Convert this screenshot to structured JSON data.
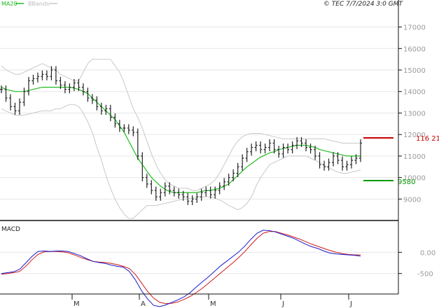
{
  "header": {
    "legend_ma": "MA20",
    "legend_bb": "BBands",
    "copyright": "© TEC 7/7/2024 3:0 GMT"
  },
  "colors": {
    "ma": "#22bb22",
    "bbands": "#c8c8c8",
    "price_bars": "#222222",
    "resistance": "#cc0000",
    "support": "#009900",
    "macd": "#1a1acc",
    "signal": "#cc1a1a",
    "grid": "#e6e6e6",
    "axis": "#111111"
  },
  "price_axis": {
    "labels": [
      "9000",
      "10000",
      "11000",
      "12000",
      "13000",
      "14000",
      "15000",
      "16000",
      "17000"
    ],
    "range": [
      8100,
      17800
    ]
  },
  "levels": {
    "resistance": {
      "value": 11621,
      "label": "116 21"
    },
    "support": {
      "value": 9580,
      "label": "9580"
    }
  },
  "macd_panel": {
    "title": "MACD",
    "labels": [
      "0.00",
      "-500"
    ]
  },
  "months": [
    "M",
    "A",
    "M",
    "J",
    "J"
  ],
  "chart_data": {
    "type": "line",
    "ylim": [
      8100,
      17800
    ],
    "price": [
      14100,
      13700,
      13300,
      13100,
      13500,
      14000,
      14500,
      14600,
      14700,
      14800,
      14700,
      15000,
      14500,
      14300,
      14100,
      14200,
      14400,
      14200,
      14000,
      13700,
      13600,
      13300,
      13100,
      13200,
      12800,
      12500,
      12300,
      12300,
      12200,
      12100,
      11000,
      10000,
      9700,
      9400,
      9100,
      9300,
      9600,
      9400,
      9300,
      9200,
      9100,
      8900,
      9000,
      9100,
      9300,
      9400,
      9200,
      9400,
      9600,
      9800,
      10000,
      10200,
      10500,
      10900,
      11200,
      11400,
      11500,
      11300,
      11400,
      11600,
      11300,
      11100,
      11400,
      11300,
      11500,
      11700,
      11600,
      11400,
      11300,
      11000,
      10600,
      10500,
      10700,
      11000,
      10800,
      10500,
      10600,
      10800,
      10900,
      11600
    ],
    "ma20": [
      14200,
      14100,
      14050,
      14000,
      14000,
      14000,
      14050,
      14100,
      14150,
      14200,
      14200,
      14200,
      14200,
      14200,
      14200,
      14200,
      14150,
      14100,
      14000,
      13900,
      13700,
      13500,
      13300,
      13100,
      12900,
      12700,
      12400,
      12100,
      11700,
      11300,
      10900,
      10600,
      10300,
      10000,
      9800,
      9600,
      9450,
      9350,
      9300,
      9300,
      9300,
      9300,
      9300,
      9300,
      9350,
      9400,
      9400,
      9450,
      9500,
      9600,
      9700,
      9900,
      10100,
      10300,
      10500,
      10650,
      10800,
      10950,
      11050,
      11150,
      11200,
      11300,
      11350,
      11400,
      11450,
      11500,
      11500,
      11500,
      11450,
      11400,
      11300,
      11250,
      11200,
      11150,
      11100,
      11050,
      11000,
      11000,
      11000,
      11000
    ],
    "bb_upper": [
      15200,
      15000,
      14900,
      14800,
      14800,
      14900,
      15000,
      15100,
      15200,
      15300,
      15200,
      15100,
      15000,
      14800,
      14700,
      14600,
      14500,
      14500,
      14900,
      15300,
      15500,
      15500,
      15500,
      15500,
      15500,
      15200,
      14900,
      14400,
      13800,
      13200,
      12800,
      12300,
      11700,
      11100,
      10600,
      10200,
      9900,
      9700,
      9600,
      9500,
      9500,
      9500,
      9400,
      9400,
      9500,
      9600,
      9700,
      9900,
      10200,
      10600,
      11000,
      11400,
      11700,
      11900,
      12000,
      12050,
      12050,
      12050,
      12000,
      11950,
      11900,
      11850,
      11800,
      11800,
      11800,
      11800,
      11800,
      11800,
      11800,
      11800,
      11800,
      11800,
      11750,
      11700,
      11650,
      11600,
      11600,
      11600,
      11600,
      11600
    ],
    "bb_lower": [
      13200,
      13100,
      13000,
      12900,
      12900,
      12900,
      12950,
      13000,
      13050,
      13100,
      13100,
      13100,
      13200,
      13200,
      13300,
      13400,
      13400,
      13300,
      13000,
      12600,
      12100,
      11400,
      10800,
      10100,
      9500,
      9000,
      8600,
      8300,
      8100,
      8100,
      8300,
      8500,
      8700,
      8700,
      8700,
      8750,
      8800,
      8850,
      8900,
      8950,
      9000,
      9000,
      9050,
      9100,
      9100,
      9100,
      9100,
      9050,
      8950,
      8850,
      8700,
      8600,
      8500,
      8600,
      8800,
      9100,
      9600,
      10000,
      10300,
      10600,
      10700,
      10800,
      10900,
      11000,
      11000,
      11000,
      11000,
      11000,
      10900,
      10800,
      10700,
      10550,
      10450,
      10350,
      10250,
      10200,
      10200,
      10250,
      10300,
      10350
    ],
    "macd": [
      -500,
      -480,
      -460,
      -400,
      -250,
      -100,
      20,
      30,
      20,
      30,
      30,
      20,
      -30,
      -80,
      -150,
      -210,
      -240,
      -260,
      -300,
      -330,
      -350,
      -450,
      -650,
      -900,
      -1100,
      -1250,
      -1280,
      -1240,
      -1180,
      -1120,
      -1050,
      -950,
      -820,
      -700,
      -580,
      -450,
      -320,
      -210,
      -100,
      10,
      150,
      310,
      450,
      520,
      510,
      480,
      430,
      380,
      330,
      260,
      190,
      130,
      90,
      30,
      -20,
      -40,
      -50,
      -60,
      -70,
      -90
    ],
    "signal": [
      -520,
      -500,
      -480,
      -450,
      -330,
      -180,
      -50,
      10,
      20,
      20,
      10,
      -10,
      -60,
      -120,
      -170,
      -210,
      -230,
      -240,
      -260,
      -290,
      -330,
      -380,
      -520,
      -720,
      -920,
      -1080,
      -1180,
      -1210,
      -1200,
      -1170,
      -1110,
      -1040,
      -950,
      -850,
      -730,
      -610,
      -490,
      -370,
      -250,
      -120,
      20,
      180,
      330,
      450,
      490,
      490,
      450,
      410,
      360,
      310,
      250,
      190,
      140,
      90,
      40,
      0,
      -30,
      -50,
      -60,
      -60
    ],
    "macd_ylim": [
      -950,
      700
    ]
  }
}
